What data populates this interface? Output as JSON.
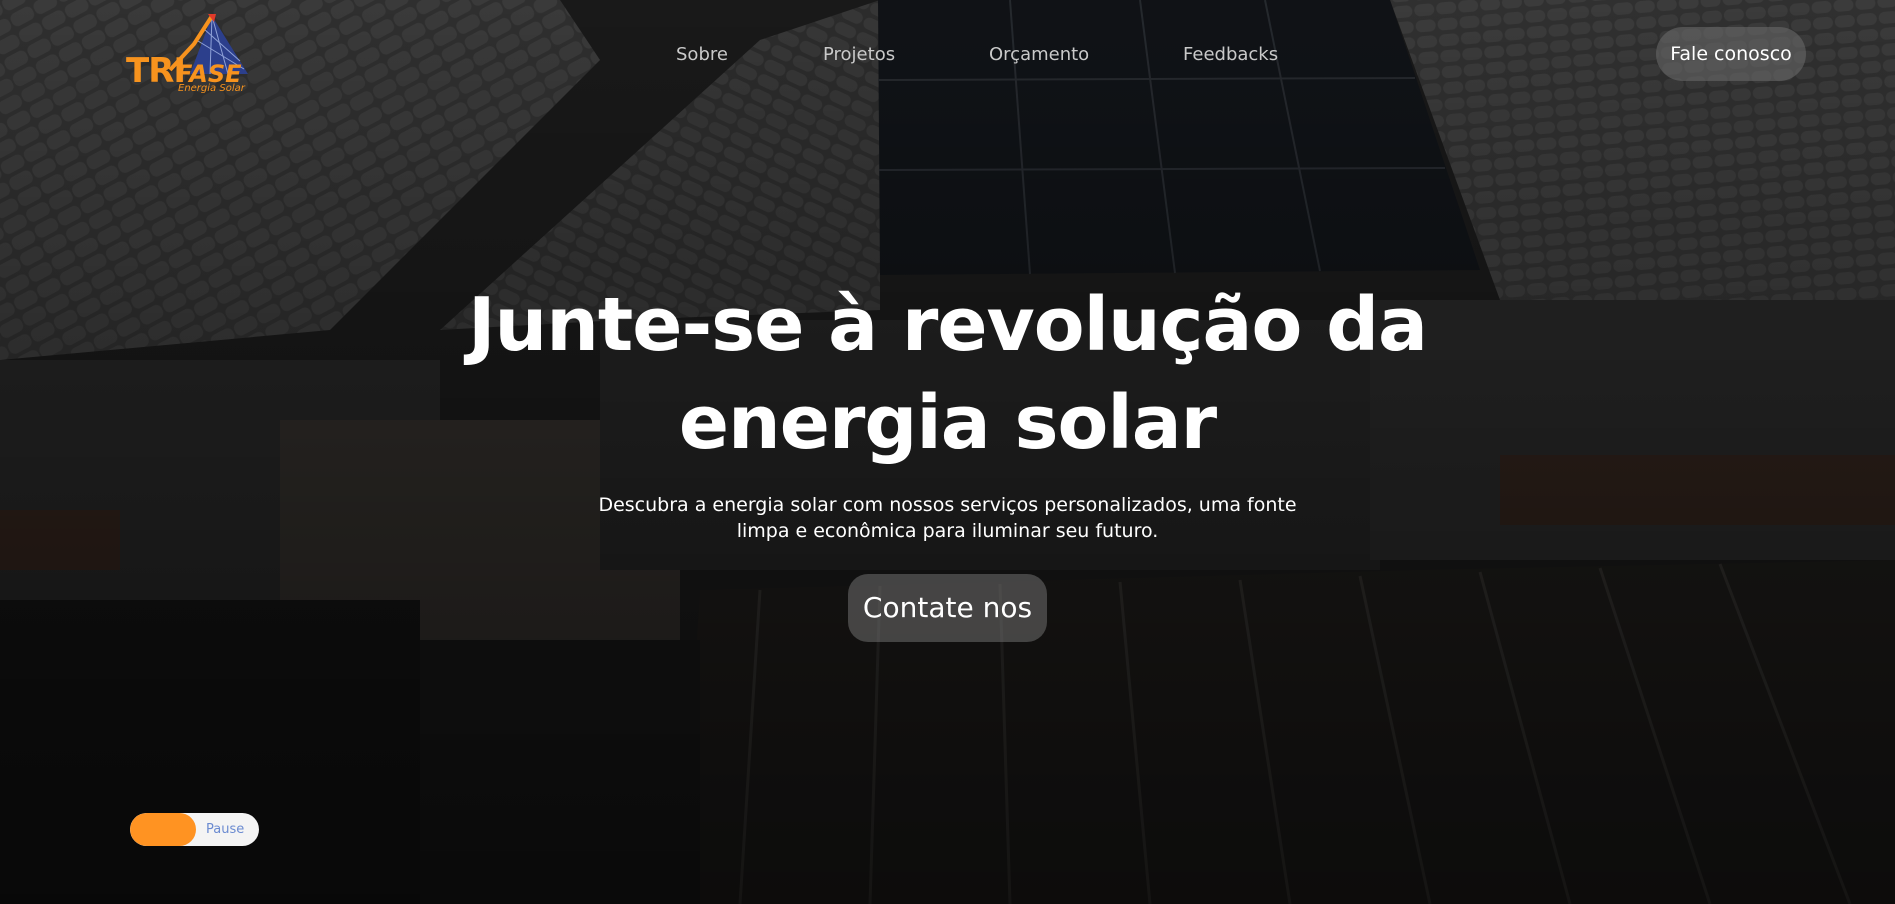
{
  "logo": {
    "brand_main": "TRI",
    "brand_second": "FASE",
    "tagline": "Energia Solar",
    "brand_color": "#f7931e",
    "mark_color": "#2c3f8c"
  },
  "nav": {
    "items": [
      {
        "label": "Sobre"
      },
      {
        "label": "Projetos"
      },
      {
        "label": "Orçamento"
      },
      {
        "label": "Feedbacks"
      }
    ],
    "cta_label": "Fale conosco"
  },
  "hero": {
    "title": "Junte-se à revolução da energia solar",
    "subtitle": "Descubra a energia solar com nossos serviços personalizados, uma fonte limpa e econômica para iluminar seu futuro.",
    "button_label": "Contate nos"
  },
  "video_control": {
    "label": "Pause",
    "accent": "#ff9322"
  }
}
